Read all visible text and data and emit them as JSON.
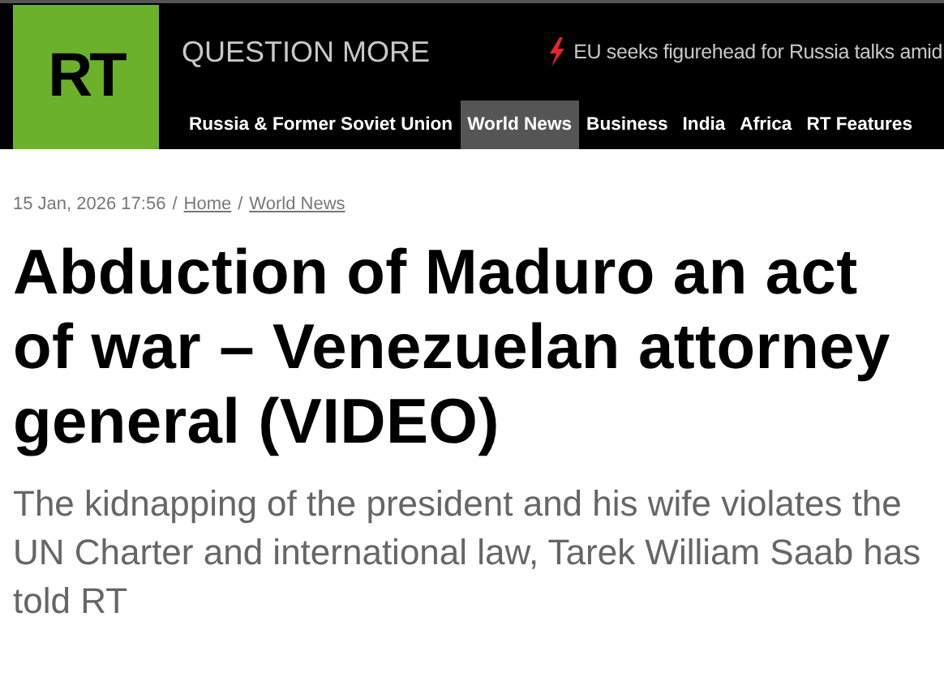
{
  "header": {
    "logo": "RT",
    "tagline": "QUESTION MORE",
    "breaking": "EU seeks figurehead for Russia talks amid",
    "nav": [
      {
        "label": "Russia & Former Soviet Union",
        "selected": false
      },
      {
        "label": "World News",
        "selected": true
      },
      {
        "label": "Business",
        "selected": false
      },
      {
        "label": "India",
        "selected": false
      },
      {
        "label": "Africa",
        "selected": false
      },
      {
        "label": "RT Features",
        "selected": false
      }
    ]
  },
  "article": {
    "date": "15 Jan, 2026 17:56",
    "breadcrumbs": [
      "Home",
      "World News"
    ],
    "separator": "/",
    "title": "Abduction of Maduro an act of war – Venezuelan attorney general (VIDEO)",
    "summary": "The kidnapping of the president and his wife violates the UN Charter and international law, Tarek William Saab has told RT"
  }
}
